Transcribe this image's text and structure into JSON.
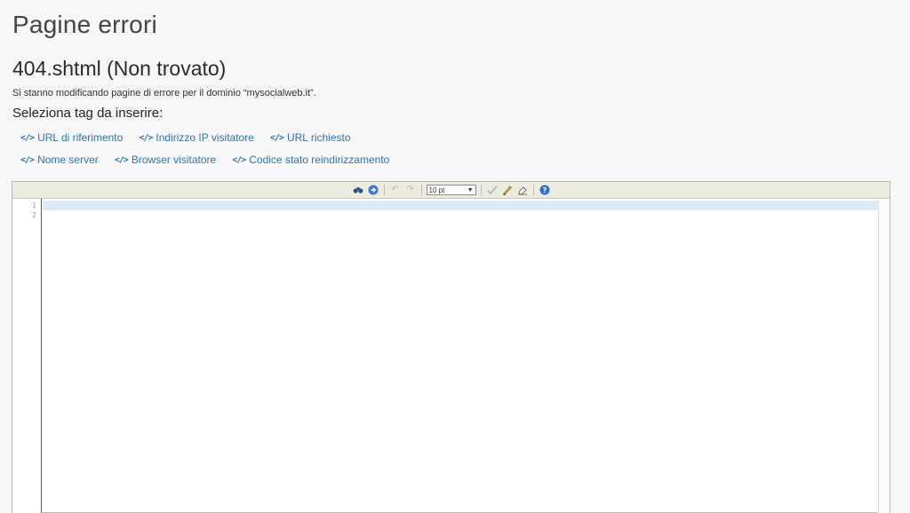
{
  "page": {
    "title": "Pagine errori",
    "file_title": "404.shtml (Non trovato)",
    "description": "Si stanno modificando pagine di errore per il dominio “mysocialweb.it”.",
    "tags_heading": "Seleziona tag da inserire:"
  },
  "tags": {
    "row1": [
      {
        "label": "URL di riferimento"
      },
      {
        "label": "Indirizzo IP visitatore"
      },
      {
        "label": "URL richiesto"
      }
    ],
    "row2": [
      {
        "label": "Nome server"
      },
      {
        "label": "Browser visitatore"
      },
      {
        "label": "Codice stato reindirizzamento"
      }
    ],
    "icon": "code-tag-icon"
  },
  "editor": {
    "toolbar": {
      "font_size": "10 pt"
    },
    "line_numbers": [
      "1",
      "2"
    ],
    "content": ""
  },
  "colors": {
    "link": "#2f75b5",
    "toolbar_bg": "#ecebe0",
    "line_highlight": "#dcebf7"
  }
}
